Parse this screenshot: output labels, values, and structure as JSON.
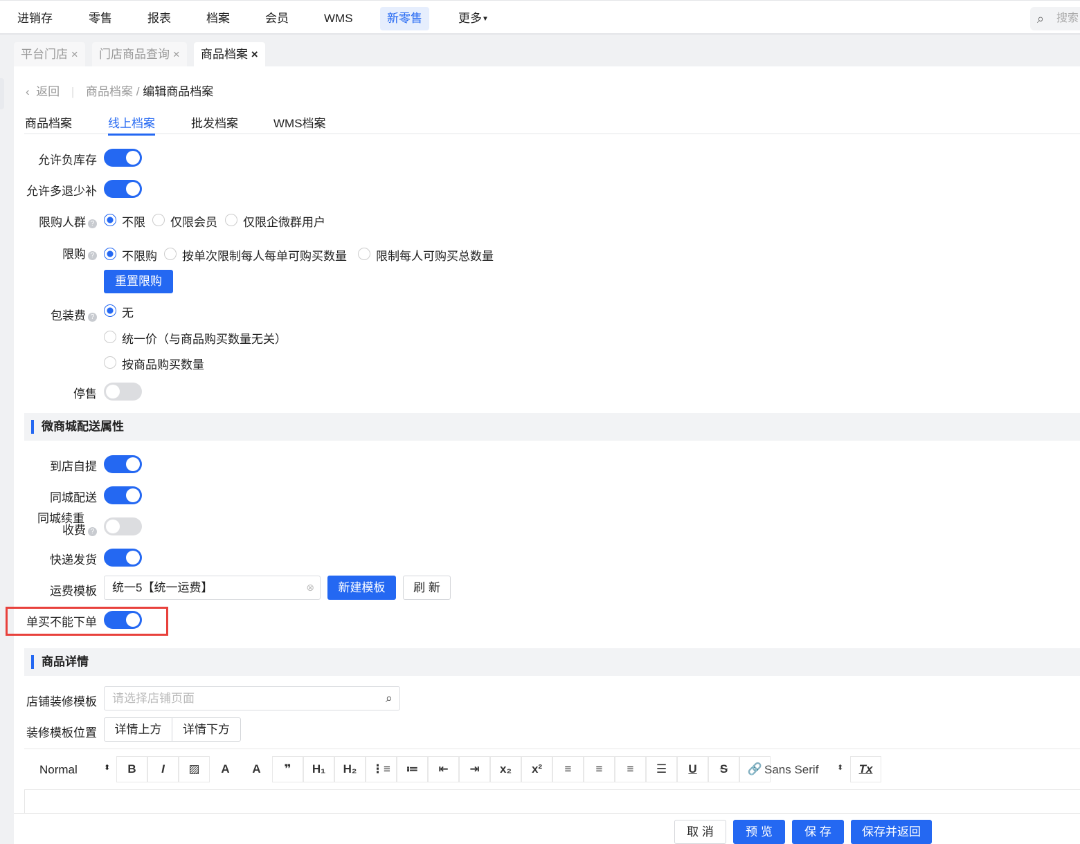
{
  "topnav": {
    "items": [
      "进销存",
      "零售",
      "报表",
      "档案",
      "会员",
      "WMS",
      "新零售",
      "更多"
    ],
    "active": "新零售",
    "search_placeholder": "搜索"
  },
  "tabs": [
    {
      "label": "平台门店"
    },
    {
      "label": "门店商品查询"
    },
    {
      "label": "商品档案",
      "active": true
    }
  ],
  "breadcrumb": {
    "back": "返回",
    "parent": "商品档案",
    "current": "编辑商品档案"
  },
  "subtabs": [
    "商品档案",
    "线上档案",
    "批发档案",
    "WMS档案"
  ],
  "form": {
    "allow_negative_stock": {
      "label": "允许负库存",
      "on": true
    },
    "allow_more_return": {
      "label": "允许多退少补",
      "on": true
    },
    "purchase_group": {
      "label": "限购人群",
      "options": [
        "不限",
        "仅限会员",
        "仅限企微群用户"
      ],
      "selected": "不限"
    },
    "purchase_limit": {
      "label": "限购",
      "options": [
        "不限购",
        "按单次限制每人每单可购买数量",
        "限制每人可购买总数量"
      ],
      "selected": "不限购",
      "reset_button": "重置限购"
    },
    "packaging_fee": {
      "label": "包装费",
      "options": [
        "无",
        "统一价（与商品购买数量无关）",
        "按商品购买数量"
      ],
      "selected": "无"
    },
    "stop_sale": {
      "label": "停售",
      "on": false
    }
  },
  "delivery_section": {
    "title": "微商城配送属性",
    "self_pickup": {
      "label": "到店自提",
      "on": true
    },
    "city_delivery": {
      "label": "同城配送",
      "on": true
    },
    "city_weight_fee": {
      "label_line1": "同城续重",
      "label_line2": "收费",
      "on": false
    },
    "express": {
      "label": "快递发货",
      "on": true
    },
    "freight_template": {
      "label": "运费模板",
      "value": "统一5【统一运费】",
      "new_button": "新建模板",
      "refresh_button": "刷 新"
    },
    "no_single_order": {
      "label": "单买不能下单",
      "on": true
    }
  },
  "detail_section": {
    "title": "商品详情",
    "store_template": {
      "label": "店铺装修模板",
      "placeholder": "请选择店铺页面"
    },
    "template_position": {
      "label": "装修模板位置",
      "options": [
        "详情上方",
        "详情下方"
      ]
    }
  },
  "editor": {
    "header_select": "Normal",
    "font_select": "Sans Serif",
    "tools": [
      {
        "icon": "bold-icon",
        "g": "B"
      },
      {
        "icon": "italic-icon",
        "g": "I"
      },
      {
        "icon": "image-icon",
        "g": "▨"
      },
      {
        "icon": "font-color-icon",
        "g": "A"
      },
      {
        "icon": "background-color-icon",
        "g": "A"
      },
      {
        "icon": "blockquote-icon",
        "g": "❞"
      },
      {
        "icon": "header1-icon",
        "g": "H₁"
      },
      {
        "icon": "header2-icon",
        "g": "H₂"
      },
      {
        "icon": "ordered-list-icon",
        "g": "⋮≡"
      },
      {
        "icon": "bullet-list-icon",
        "g": "≔"
      },
      {
        "icon": "outdent-icon",
        "g": "⇤"
      },
      {
        "icon": "indent-icon",
        "g": "⇥"
      },
      {
        "icon": "subscript-icon",
        "g": "x₂"
      },
      {
        "icon": "superscript-icon",
        "g": "x²"
      },
      {
        "icon": "align-left-icon",
        "g": "≡"
      },
      {
        "icon": "align-center-icon",
        "g": "≡"
      },
      {
        "icon": "align-right-icon",
        "g": "≡"
      },
      {
        "icon": "align-justify-icon",
        "g": "☰"
      },
      {
        "icon": "underline-icon",
        "g": "U"
      },
      {
        "icon": "strike-icon",
        "g": "S"
      },
      {
        "icon": "link-icon",
        "g": "🔗"
      }
    ],
    "clean_glyph": "Tx"
  },
  "footer": {
    "cancel": "取 消",
    "preview": "预 览",
    "save": "保 存",
    "save_return": "保存并返回"
  },
  "colors": {
    "accent": "#2468f2",
    "highlight": "#e8413c"
  }
}
